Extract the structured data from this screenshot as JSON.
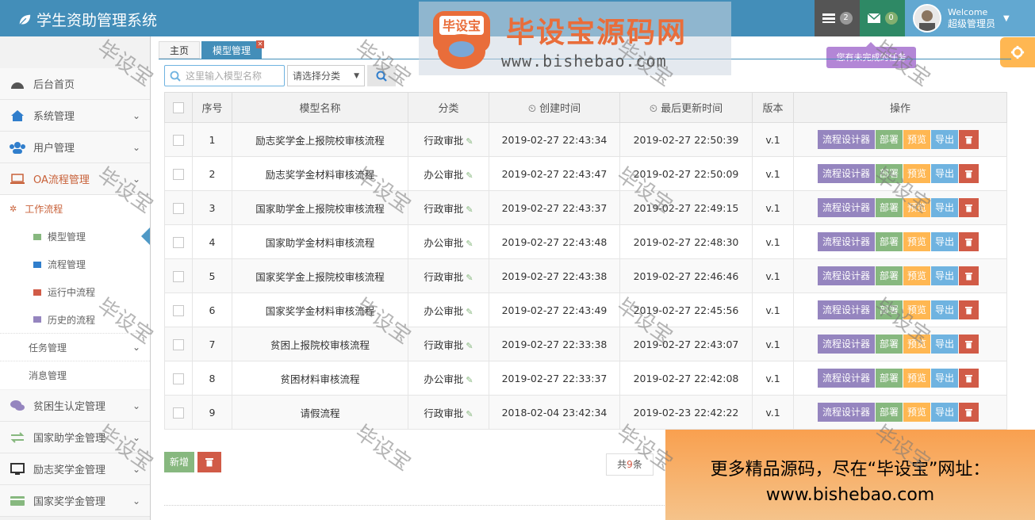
{
  "app": {
    "title": "学生资助管理系统"
  },
  "header": {
    "tasks_count": "2",
    "messages_count": "0",
    "welcome": "Welcome",
    "user_name": "超级管理员",
    "tooltip": "您有未完成的任务"
  },
  "sidebar": {
    "items": [
      {
        "label": "后台首页",
        "icon": "dashboard-icon"
      },
      {
        "label": "系统管理",
        "icon": "home-icon"
      },
      {
        "label": "用户管理",
        "icon": "users-icon"
      },
      {
        "label": "OA流程管理",
        "icon": "desktop-icon"
      },
      {
        "label": "贫困生认定管理",
        "icon": "comments-icon"
      },
      {
        "label": "国家助学金管理",
        "icon": "exchange-icon"
      },
      {
        "label": "励志奖学金管理",
        "icon": "monitor-icon"
      },
      {
        "label": "国家奖学金管理",
        "icon": "credit-card-icon"
      }
    ],
    "sub": {
      "workflow": "工作流程",
      "model": "模型管理",
      "process": "流程管理",
      "running": "运行中流程",
      "history": "历史的流程",
      "task": "任务管理",
      "message": "消息管理"
    }
  },
  "tabs": [
    "主页",
    "模型管理"
  ],
  "search": {
    "placeholder": "这里输入模型名称",
    "category": "请选择分类"
  },
  "table": {
    "headers": [
      "序号",
      "模型名称",
      "分类",
      "创建时间",
      "最后更新时间",
      "版本",
      "操作"
    ],
    "rows": [
      {
        "no": "1",
        "name": "励志奖学金上报院校审核流程",
        "category": "行政审批",
        "created": "2019-02-27 22:43:34",
        "updated": "2019-02-27 22:50:39",
        "version": "v.1"
      },
      {
        "no": "2",
        "name": "励志奖学金材料审核流程",
        "category": "办公审批",
        "created": "2019-02-27 22:43:47",
        "updated": "2019-02-27 22:50:09",
        "version": "v.1"
      },
      {
        "no": "3",
        "name": "国家助学金上报院校审核流程",
        "category": "行政审批",
        "created": "2019-02-27 22:43:37",
        "updated": "2019-02-27 22:49:15",
        "version": "v.1"
      },
      {
        "no": "4",
        "name": "国家助学金材料审核流程",
        "category": "办公审批",
        "created": "2019-02-27 22:43:48",
        "updated": "2019-02-27 22:48:30",
        "version": "v.1"
      },
      {
        "no": "5",
        "name": "国家奖学金上报院校审核流程",
        "category": "行政审批",
        "created": "2019-02-27 22:43:38",
        "updated": "2019-02-27 22:46:46",
        "version": "v.1"
      },
      {
        "no": "6",
        "name": "国家奖学金材料审核流程",
        "category": "办公审批",
        "created": "2019-02-27 22:43:49",
        "updated": "2019-02-27 22:45:56",
        "version": "v.1"
      },
      {
        "no": "7",
        "name": "贫困上报院校审核流程",
        "category": "行政审批",
        "created": "2019-02-27 22:33:38",
        "updated": "2019-02-27 22:43:07",
        "version": "v.1"
      },
      {
        "no": "8",
        "name": "贫困材料审核流程",
        "category": "办公审批",
        "created": "2019-02-27 22:33:37",
        "updated": "2019-02-27 22:42:08",
        "version": "v.1"
      },
      {
        "no": "9",
        "name": "请假流程",
        "category": "行政审批",
        "created": "2018-02-04 23:42:34",
        "updated": "2019-02-23 22:42:22",
        "version": "v.1"
      }
    ],
    "actions": {
      "design": "流程设计器",
      "deploy": "部署",
      "preview": "预览",
      "export": "导出"
    }
  },
  "footer": {
    "add": "新增",
    "total_prefix": "共",
    "total_count": "9",
    "total_suffix": "条"
  },
  "banner": {
    "line1": "更多精品源码，尽在“毕设宝”网址：",
    "line2": "www.bishebao.com"
  },
  "watermark": {
    "brand": "毕设宝源码网",
    "url": "www.bishebao.com",
    "stamp": "毕设宝",
    "small": "毕设宝"
  }
}
